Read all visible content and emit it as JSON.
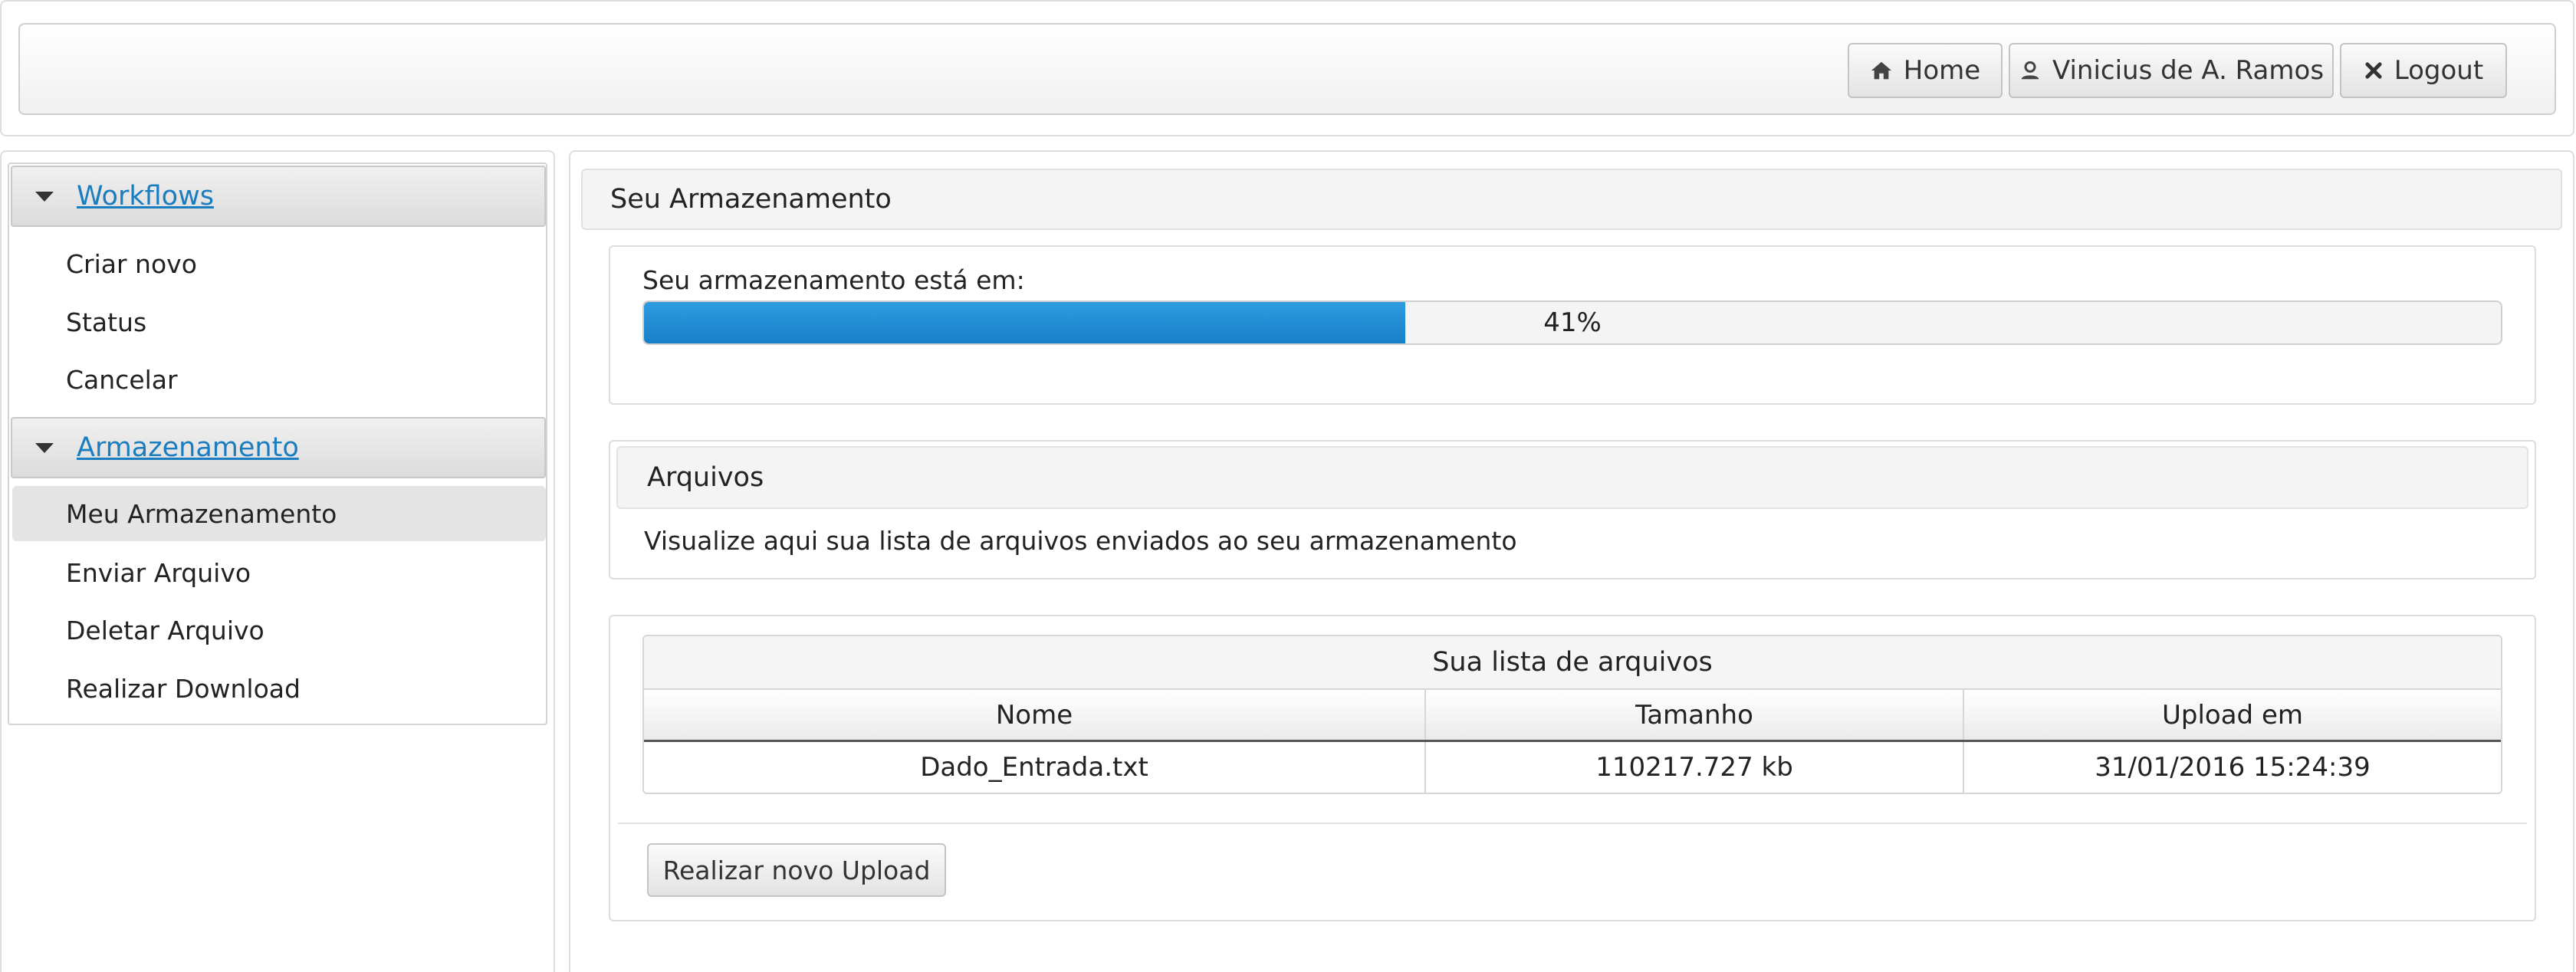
{
  "header": {
    "home_label": "Home",
    "user_label": "Vinicius de A. Ramos",
    "logout_label": "Logout"
  },
  "sidebar": {
    "sections": [
      {
        "title": "Workflows",
        "items": [
          "Criar novo",
          "Status",
          "Cancelar"
        ]
      },
      {
        "title": "Armazenamento",
        "items": [
          "Meu Armazenamento",
          "Enviar Arquivo",
          "Deletar Arquivo",
          "Realizar Download"
        ]
      }
    ],
    "active_item": "Meu Armazenamento"
  },
  "main": {
    "panel_title": "Seu Armazenamento",
    "storage": {
      "label": "Seu armazenamento está em:",
      "percent_text": "41%",
      "percent": 41,
      "bar_color": "#1a86cf"
    },
    "files": {
      "title": "Arquivos",
      "description": "Visualize aqui sua lista de arquivos enviados ao seu armazenamento"
    },
    "table": {
      "caption": "Sua lista de arquivos",
      "columns": [
        "Nome",
        "Tamanho",
        "Upload em"
      ],
      "rows": [
        [
          "Dado_Entrada.txt",
          "110217.727 kb",
          "31/01/2016 15:24:39"
        ]
      ]
    },
    "upload_button_label": "Realizar novo Upload"
  },
  "colors": {
    "link": "#1a7dc0",
    "progress": "#1a86cf"
  }
}
